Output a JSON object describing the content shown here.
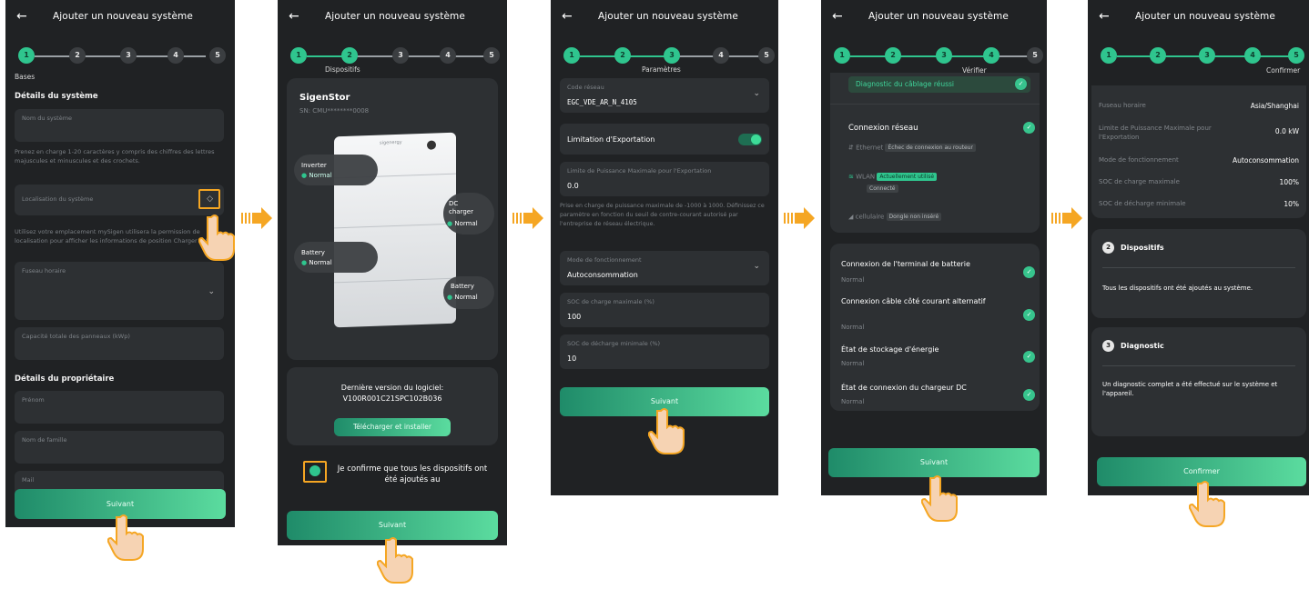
{
  "steps": [
    "1",
    "2",
    "3",
    "4",
    "5"
  ],
  "screen1": {
    "title": "Ajouter un nouveau système",
    "step_label": "Bases",
    "section_system": "Détails du système",
    "system_name_label": "Nom du système",
    "system_name_help": "Prenez en charge 1-20 caractères y compris des chiffres des lettres majuscules et minuscules et des crochets.",
    "location_label": "Localisation du système",
    "location_help": "Utilisez votre emplacement mySigen utilisera la permission de localisation pour afficher les informations de position Charger EV.",
    "timezone_label": "Fuseau horaire",
    "capacity_label": "Capacité totale des panneaux (kWp)",
    "section_owner": "Détails du propriétaire",
    "firstname_label": "Prénom",
    "lastname_label": "Nom de famille",
    "email_label": "Mail",
    "next_button": "Suivant"
  },
  "screen2": {
    "title": "Ajouter un nouveau système",
    "step_label": "Dispositifs",
    "device_name": "SigenStor",
    "device_sn": "SN: CMU********0008",
    "brand": "sigenergy",
    "modules": [
      {
        "name": "Inverter",
        "status": "Normal"
      },
      {
        "name": "DC charger",
        "status": "Normal"
      },
      {
        "name": "Battery",
        "status": "Normal"
      },
      {
        "name": "Battery",
        "status": "Normal"
      }
    ],
    "software_label": "Dernière version du logiciel:",
    "software_version": "V100R001C21SPC102B036",
    "download_button": "Télécharger et installer",
    "confirm_text": "Je confirme que tous les dispositifs ont été ajoutés au",
    "next_button": "Suivant"
  },
  "screen3": {
    "title": "Ajouter un nouveau système",
    "step_label": "Paramètres",
    "grid_code_label": "Code réseau",
    "grid_code_value": "EGC_VDE_AR_N_4105",
    "export_limit_label": "Limitation d'Exportation",
    "max_power_label": "Limite de Puissance Maximale pour l'Exportation",
    "max_power_value": "0.0",
    "max_power_help": "Prise en charge de puissance maximale de -1000 à 1000. Définissez ce paramètre en fonction du seuil de contre-courant autorisé par l'entreprise de réseau électrique.",
    "mode_label": "Mode de fonctionnement",
    "mode_value": "Autoconsommation",
    "soc_charge_label": "SOC de charge maximale (%)",
    "soc_charge_value": "100",
    "soc_discharge_label": "SOC de décharge minimale (%)",
    "soc_discharge_value": "10",
    "next_button": "Suivant"
  },
  "screen4": {
    "title": "Ajouter un nouveau système",
    "step_label": "Vérifier",
    "wiring_ok": "Diagnostic du câblage réussi",
    "network_title": "Connexion réseau",
    "ethernet_label": "Ethernet",
    "ethernet_tag": "Échec de connexion au routeur",
    "wlan_label": "WLAN",
    "wlan_tag": "Actuellement utilisé",
    "wlan_status": "Connecté",
    "cellular_label": "cellulaire",
    "cellular_tag": "Dongle non inséré",
    "checks": [
      {
        "title": "Connexion de l'terminal de batterie",
        "status": "Normal"
      },
      {
        "title": "Connexion câble côté courant alternatif",
        "status": "Normal"
      },
      {
        "title": "État de stockage d'énergie",
        "status": "Normal"
      },
      {
        "title": "État de connexion du chargeur DC",
        "status": "Normal"
      }
    ],
    "next_button": "Suivant"
  },
  "screen5": {
    "title": "Ajouter un nouveau système",
    "step_label": "Confirmer",
    "rows": [
      {
        "label": "Fuseau horaire",
        "value": "Asia/Shanghai"
      },
      {
        "label": "Limite de Puissance Maximale pour l'Exportation",
        "value": "0.0 kW"
      },
      {
        "label": "Mode de fonctionnement",
        "value": "Autoconsommation"
      },
      {
        "label": "SOC de charge maximale",
        "value": "100%"
      },
      {
        "label": "SOC de décharge minimale",
        "value": "10%"
      }
    ],
    "devices_num": "2",
    "devices_title": "Dispositifs",
    "devices_text": "Tous les dispositifs ont été ajoutés au système.",
    "diag_num": "3",
    "diag_title": "Diagnostic",
    "diag_text": "Un diagnostic complet a été effectué sur le système et l'appareil.",
    "confirm_button": "Confirmer"
  },
  "colors": {
    "accent": "#2fc58e",
    "highlight": "#f5a623",
    "background": "#202224"
  }
}
